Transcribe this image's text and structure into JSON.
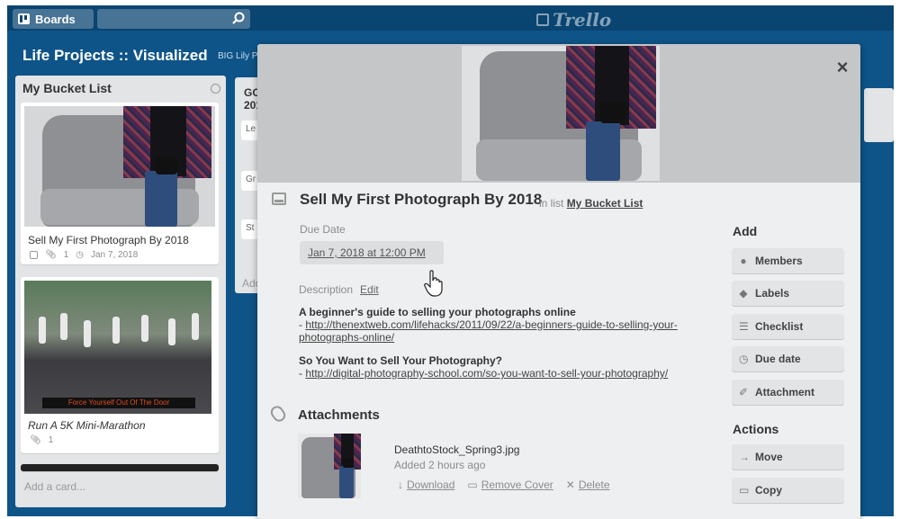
{
  "header": {
    "boards_label": "Boards",
    "search_placeholder": "",
    "logo_text": "Trello"
  },
  "board": {
    "title": "Life Projects :: Visualized",
    "subtitle": "BIG Lily P"
  },
  "lists": [
    {
      "title": "My Bucket List",
      "cards": [
        {
          "title": "Sell My First Photograph By 2018",
          "attachments": "1",
          "due": "Jan 7, 2018"
        },
        {
          "title": "Run A 5K Mini-Marathon",
          "attachments": "1",
          "image_caption": "Force Yourself Out Of The Door"
        }
      ],
      "add_card": "Add a card..."
    },
    {
      "title": "GO",
      "title_2": "201",
      "items": [
        "Le",
        "Gr",
        "St"
      ],
      "add": "Add"
    }
  ],
  "modal": {
    "card_title": "Sell My First Photograph By 2018",
    "in_list_prefix": "in list",
    "list_name": "My Bucket List",
    "due_date_label": "Due Date",
    "due_date_value": "Jan 7, 2018 at 12:00 PM",
    "description_label": "Description",
    "edit_label": "Edit",
    "description": [
      {
        "heading": "A beginner's guide to selling your photographs online",
        "prefix": "- ",
        "link_line1": "http://thenextweb.com/lifehacks/2011/09/22/a-beginners-guide-to-selling-your-",
        "link_line2": "photographs-online/"
      },
      {
        "heading": "So You Want to Sell Your Photography?",
        "prefix": "- ",
        "link_line1": "http://digital-photography-school.com/so-you-want-to-sell-your-photography/"
      }
    ],
    "attachments_heading": "Attachments",
    "attachment": {
      "name": "DeathtoStock_Spring3.jpg",
      "added": "Added 2 hours ago",
      "download": "Download",
      "remove_cover": "Remove Cover",
      "delete": "Delete"
    },
    "add_heading": "Add",
    "add_buttons": [
      "Members",
      "Labels",
      "Checklist",
      "Due date",
      "Attachment"
    ],
    "actions_heading": "Actions",
    "action_buttons": [
      "Move",
      "Copy"
    ],
    "close_symbol": "×"
  },
  "colors": {
    "board_bg": "#0e5489",
    "header_bg": "#0a4470",
    "list_bg": "#e2e4e6",
    "modal_bg": "#edeff0"
  }
}
